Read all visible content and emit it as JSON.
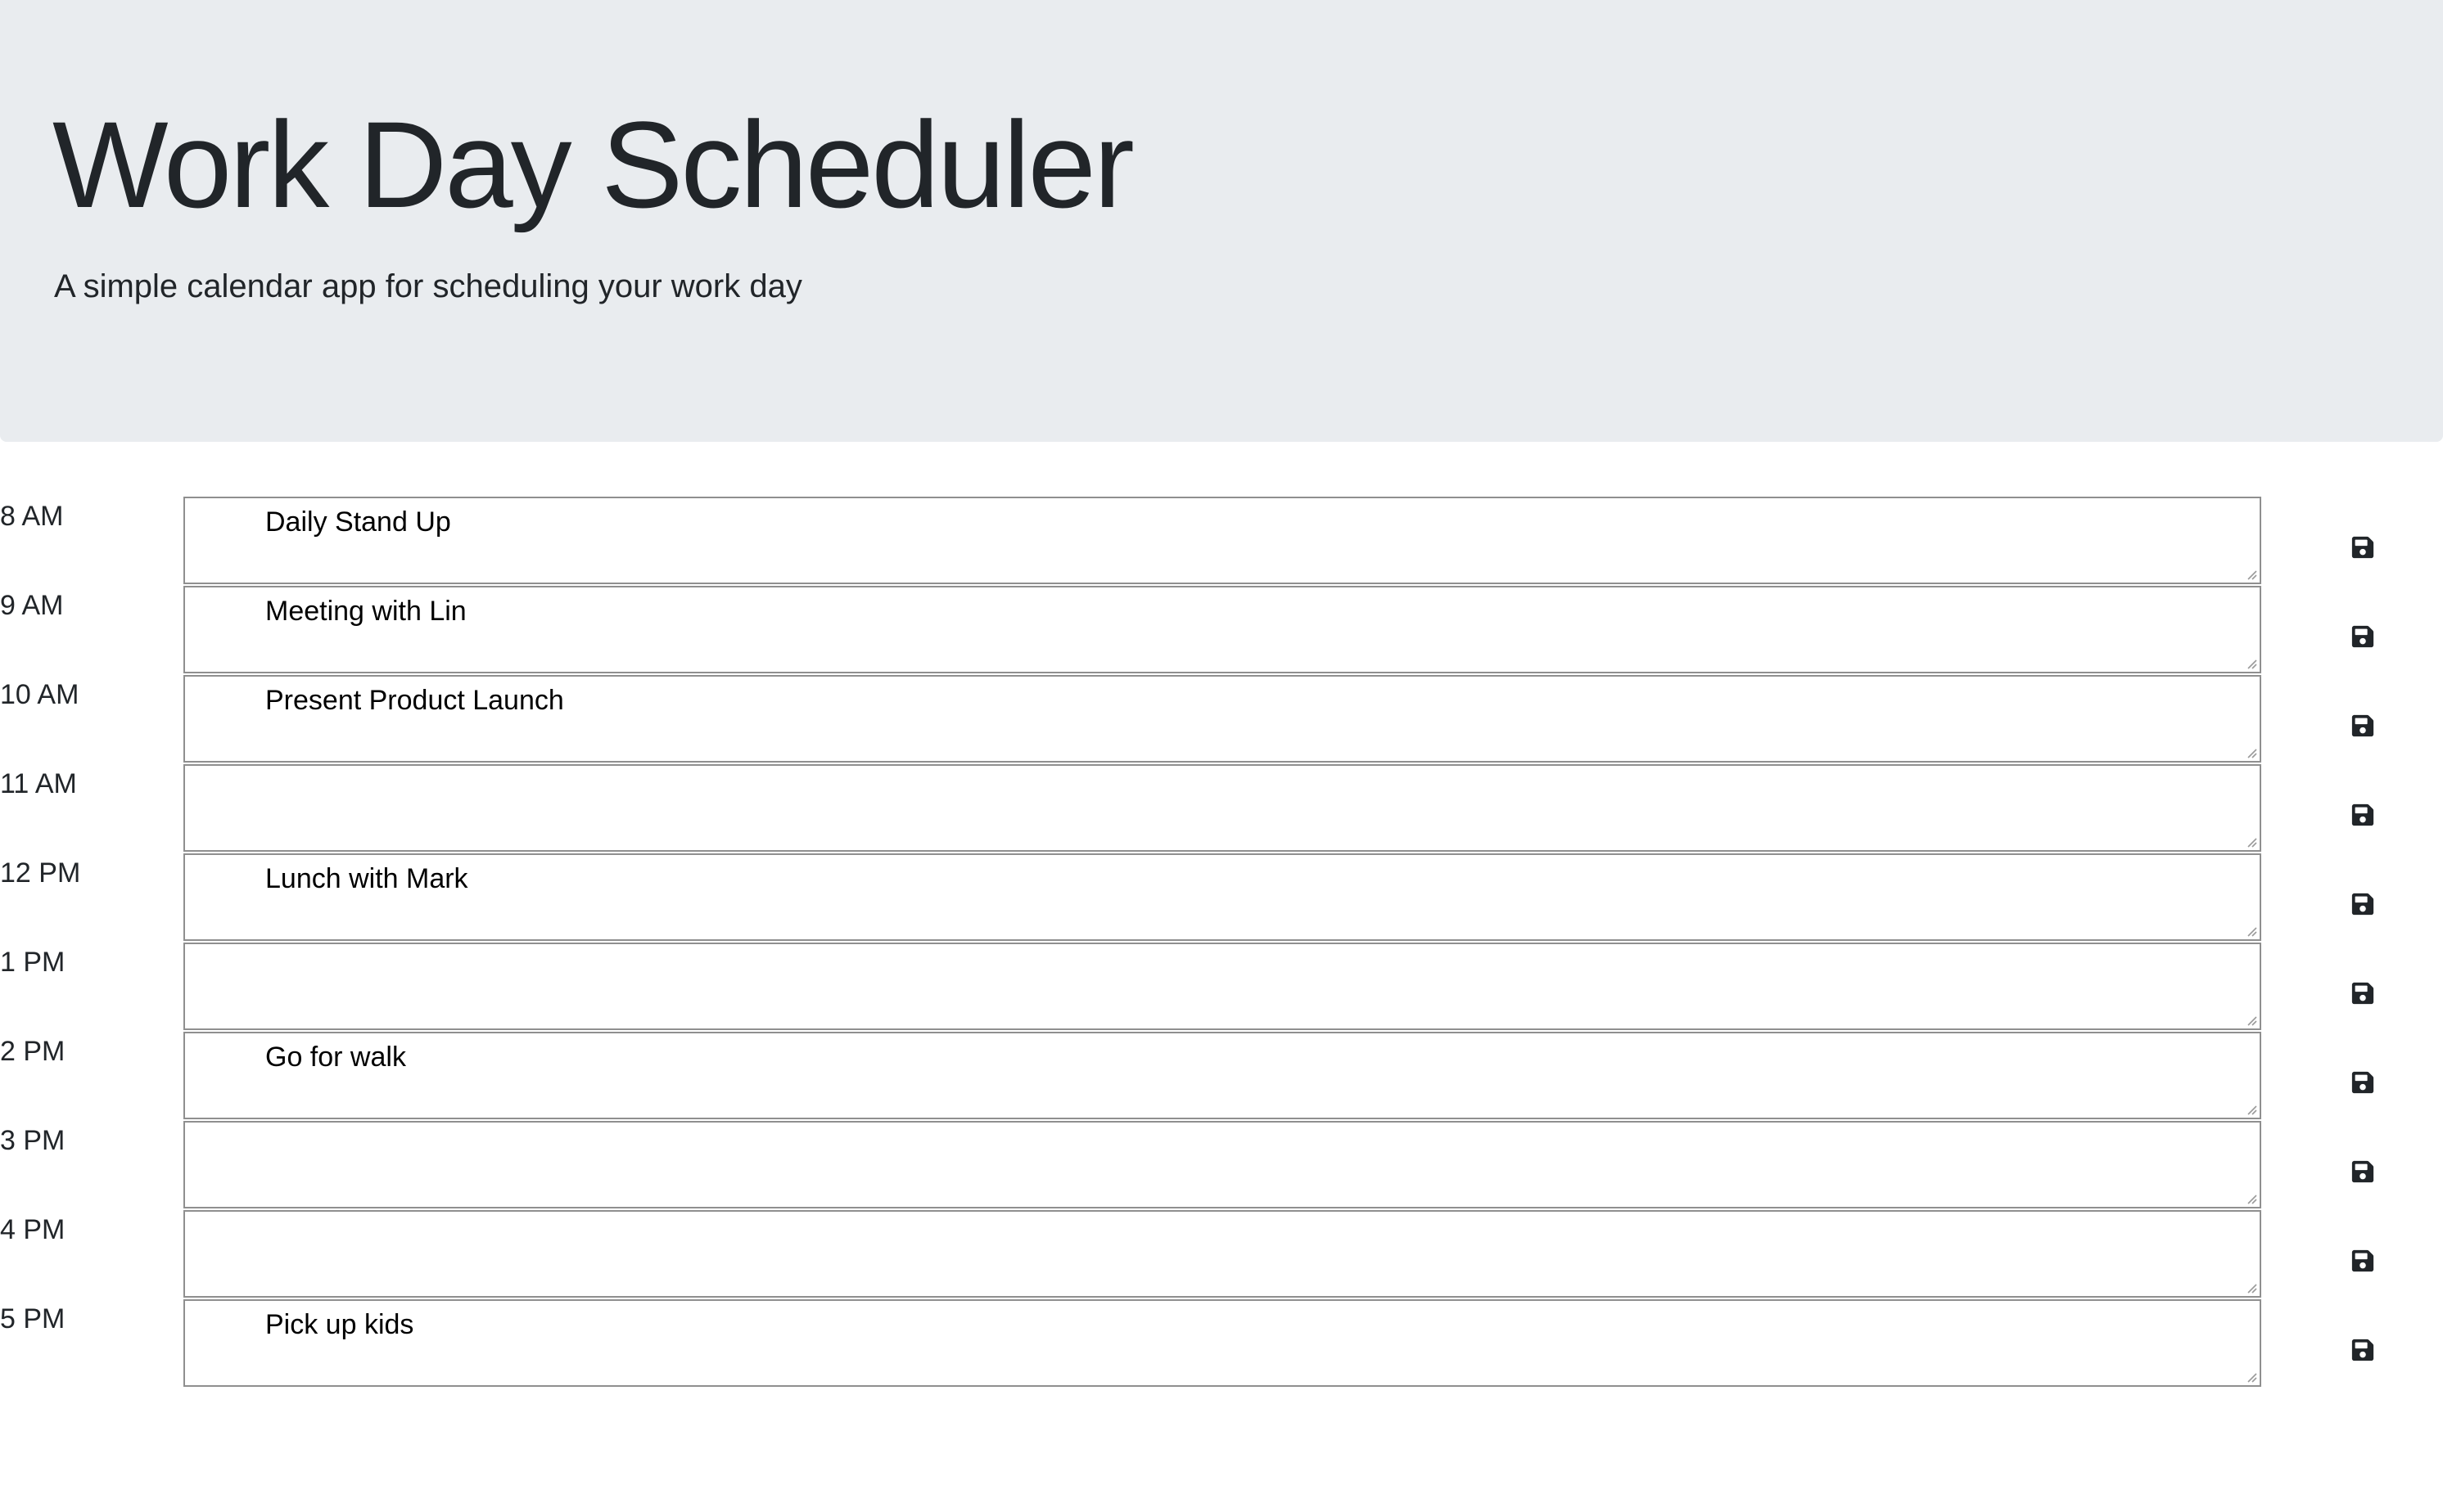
{
  "header": {
    "title": "Work Day Scheduler",
    "subtitle": "A simple calendar app for scheduling your work day"
  },
  "colors": {
    "header_bg": "#e9ecef",
    "text": "#212529",
    "field_border": "#8f8f8f"
  },
  "schedule": {
    "save_icon": "floppy-disk-icon",
    "rows": [
      {
        "hour": "8 AM",
        "entry": "Daily Stand Up"
      },
      {
        "hour": "9 AM",
        "entry": "Meeting with Lin"
      },
      {
        "hour": "10 AM",
        "entry": "Present Product Launch"
      },
      {
        "hour": "11 AM",
        "entry": ""
      },
      {
        "hour": "12 PM",
        "entry": "Lunch with Mark"
      },
      {
        "hour": "1 PM",
        "entry": ""
      },
      {
        "hour": "2 PM",
        "entry": "Go for walk"
      },
      {
        "hour": "3 PM",
        "entry": ""
      },
      {
        "hour": "4 PM",
        "entry": ""
      },
      {
        "hour": "5 PM",
        "entry": "Pick up kids"
      }
    ]
  }
}
